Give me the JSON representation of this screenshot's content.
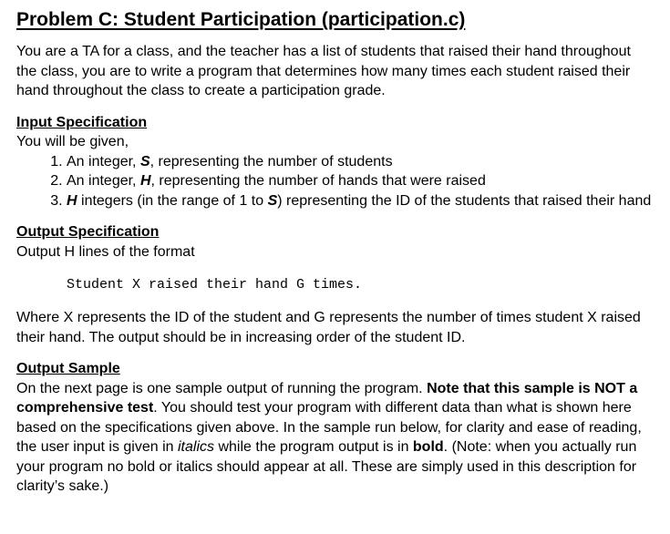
{
  "title": "Problem C: Student Participation (participation.c)",
  "intro": "You are a TA for a class, and the teacher has a list of students that raised their hand throughout the class, you are to write a program that determines how many times each student raised their hand throughout the class to create a participation grade.",
  "input_spec": {
    "heading": "Input Specification",
    "lead": "You will be given,",
    "items": [
      {
        "before": "An integer, ",
        "var": "S",
        "after": ", representing the number of students"
      },
      {
        "before": "An integer, ",
        "var": "H",
        "after": ", representing the number of hands that were raised"
      },
      {
        "before": "",
        "var": "H",
        "middle": " integers (in the range of 1 to ",
        "var2": "S",
        "after": ") representing the ID of the students that raised their hand"
      }
    ]
  },
  "output_spec": {
    "heading": "Output Specification",
    "lead": "Output H lines of the format",
    "code": "Student X raised their hand G times.",
    "explanation": "Where X represents the ID of the student and G represents the number of times student X raised their hand. The output should be in increasing order of the student ID."
  },
  "output_sample": {
    "heading": "Output Sample",
    "text_1": "On the next page is one sample output of running the program. ",
    "bold_1": "Note that this sample is NOT a comprehensive test",
    "text_2": ". You should test your program with different data than what is shown here based on the specifications given above. In the sample run below, for clarity and ease of reading, the user input is given in ",
    "italic_1": "italics",
    "text_3": " while the program output is in ",
    "bold_2": "bold",
    "text_4": ". (Note: when you actually run your program no bold or italics should appear at all. These are simply used in this description for clarity’s sake.)"
  }
}
